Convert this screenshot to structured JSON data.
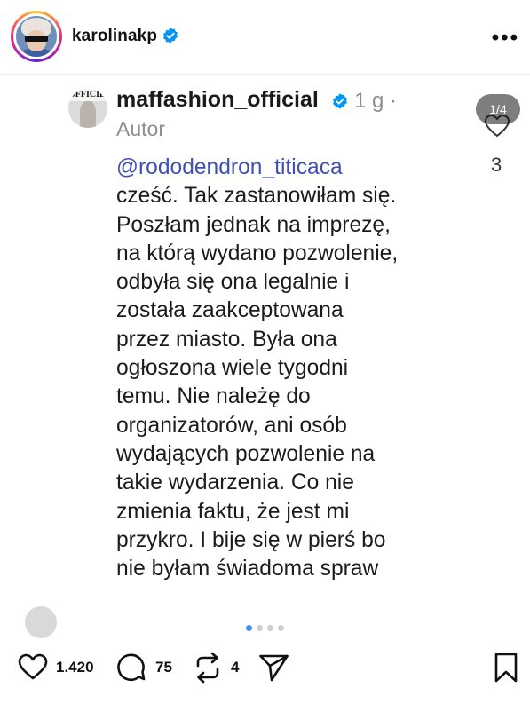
{
  "header": {
    "username": "karolinakp",
    "verified": true,
    "more_icon": "more-horizontal-icon"
  },
  "comment": {
    "username": "maffashion_official",
    "verified": true,
    "time": "1 g ·",
    "role": "Autor",
    "mention": "@rododendron_titicaca",
    "body": "cześć. Tak zastanowiłam się.\nPoszłam jednak na imprezę,\nna którą wydano pozwolenie,\nodbyła się ona legalnie i\nzostała zaakceptowana\nprzez miasto. Była ona\nogłoszona wiele tygodni\ntemu. Nie należę do\norganizatorów, ani osób\nwydających pozwolenie na\ntakie wydarzenia. Co nie\nzmienia faktu, że jest mi\nprzykro. I bije się w pierś bo\nnie byłam świadoma spraw",
    "avatar_text": "OFFICIEL",
    "like_count": "3"
  },
  "carousel": {
    "counter": "1/4",
    "total": 4,
    "active_index": 0
  },
  "actions": {
    "likes": "1.420",
    "comments": "75",
    "reposts": "4"
  },
  "colors": {
    "mention": "#3f51b5",
    "verified": "#0095f6",
    "active_dot": "#3f8ef7"
  }
}
